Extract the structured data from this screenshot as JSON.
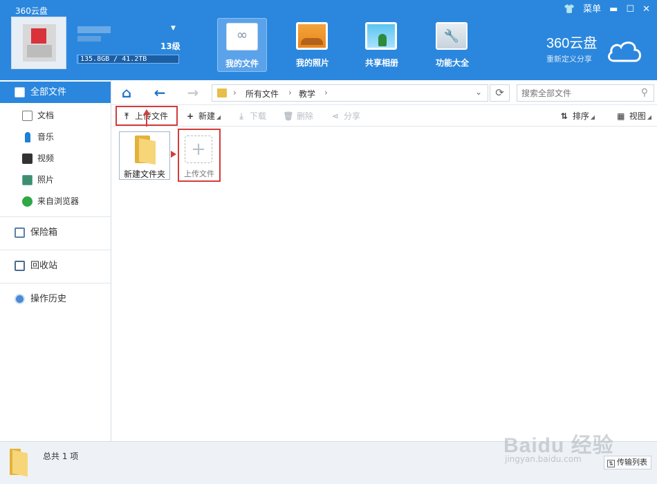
{
  "app": {
    "title": "360云盘",
    "menu_label": "菜单"
  },
  "user": {
    "level": "13级",
    "storage": "135.8GB / 41.2TB",
    "storage_used_fraction": 0.003
  },
  "nav": {
    "items": [
      {
        "label": "我的文件",
        "active": true
      },
      {
        "label": "我的照片"
      },
      {
        "label": "共享相册"
      },
      {
        "label": "功能大全"
      }
    ]
  },
  "brand": {
    "name": "360云盘",
    "slogan": "重新定义分享"
  },
  "sidebar": {
    "all_files": "全部文件",
    "docs": "文档",
    "music": "音乐",
    "video": "视频",
    "photos": "照片",
    "browser": "来自浏览器",
    "vault": "保险箱",
    "recycle": "回收站",
    "history": "操作历史"
  },
  "path": {
    "crumbs": [
      "所有文件",
      "教学"
    ]
  },
  "search": {
    "placeholder": "搜索全部文件"
  },
  "toolbar": {
    "upload": "上传文件",
    "new": "新建",
    "download": "下载",
    "delete": "删除",
    "share": "分享",
    "sort": "排序",
    "view": "视图"
  },
  "content": {
    "folder_name": "新建文件夹",
    "upload_tile_label": "上传文件"
  },
  "status": {
    "count": "总共 1 项",
    "transfer_list": "传输列表"
  },
  "watermark": {
    "text": "Baidu 经验",
    "url": "jingyan.baidu.com"
  },
  "colors": {
    "header": "#2b87dd",
    "highlight_red": "#d33b3b"
  }
}
